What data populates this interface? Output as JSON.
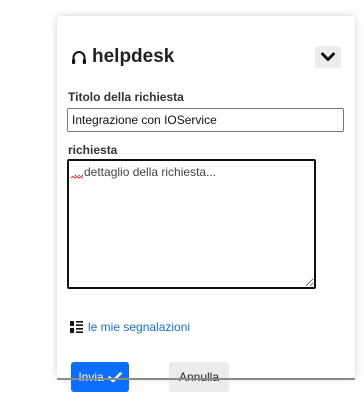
{
  "header": {
    "title": "helpdesk",
    "headset_icon": "headset-icon",
    "toggle_icon": "chevron-down-icon"
  },
  "form": {
    "title_label": "Titolo della richiesta",
    "title_value": "Integrazione con IOService",
    "request_label": "richiesta",
    "request_placeholder": "...dettaglio della richiesta...",
    "request_value": ""
  },
  "links": {
    "my_reports": "le mie segnalazioni",
    "my_reports_icon": "list-icon"
  },
  "actions": {
    "send_label": "Invia",
    "send_icon": "check-icon",
    "cancel_label": "Annulla"
  },
  "colors": {
    "primary": "#0d6efd",
    "link": "#1a6fbf",
    "secondary_button": "#ececec"
  }
}
